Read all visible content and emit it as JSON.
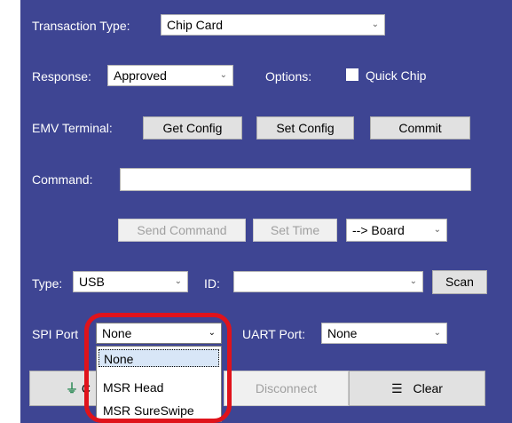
{
  "transaction": {
    "label": "Transaction Type:",
    "value": "Chip Card"
  },
  "response": {
    "label": "Response:",
    "value": "Approved"
  },
  "options": {
    "label": "Options:",
    "quick_chip_label": "Quick Chip",
    "quick_chip_checked": false
  },
  "emv": {
    "label": "EMV Terminal:",
    "get_config": "Get Config",
    "set_config": "Set Config",
    "commit": "Commit"
  },
  "command": {
    "label": "Command:",
    "value": ""
  },
  "actions": {
    "send_command": "Send Command",
    "set_time": "Set Time",
    "board_value": "--> Board"
  },
  "connection": {
    "type_label": "Type:",
    "type_value": "USB",
    "id_label": "ID:",
    "id_value": "",
    "scan": "Scan"
  },
  "ports": {
    "spi_label": "SPI Port",
    "spi_value": "None",
    "spi_options": [
      "None",
      "MSR Head",
      "MSR SureSwipe"
    ],
    "uart_label": "UART Port:",
    "uart_value": "None"
  },
  "bottom": {
    "connect_partial": "C",
    "disconnect": "Disconnect",
    "clear": "Clear"
  },
  "colors": {
    "panel_bg": "#3e4593",
    "highlight": "#e0131b"
  },
  "icons": {
    "connect": "plug-icon",
    "clear": "clear-list-icon",
    "dropdown": "chevron-down-icon"
  }
}
